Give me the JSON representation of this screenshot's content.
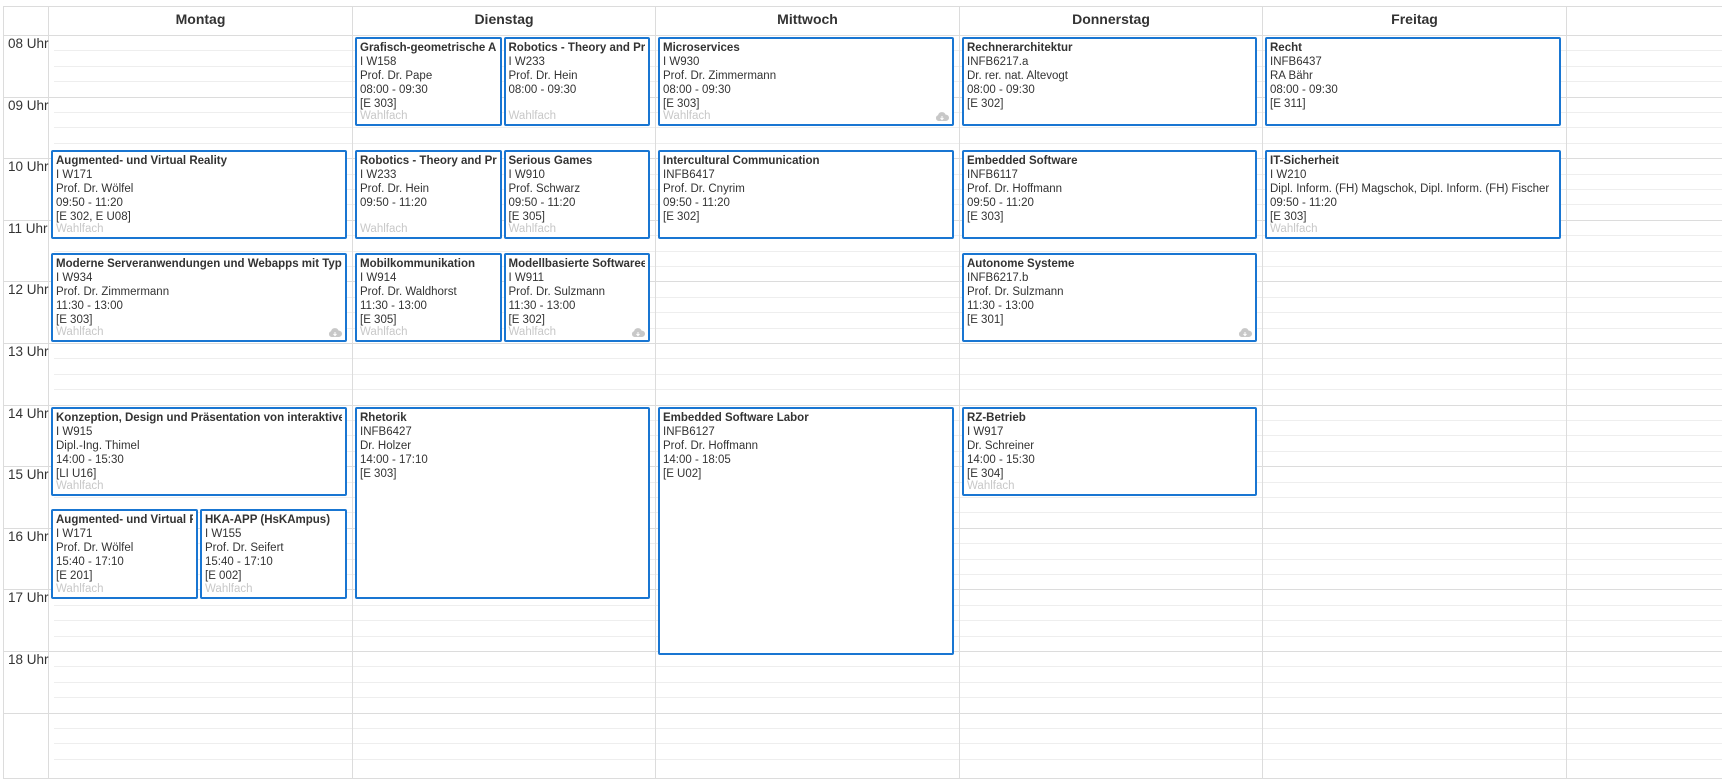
{
  "hours": [
    "08 Uhr",
    "09 Uhr",
    "10 Uhr",
    "11 Uhr",
    "12 Uhr",
    "13 Uhr",
    "14 Uhr",
    "15 Uhr",
    "16 Uhr",
    "17 Uhr",
    "18 Uhr"
  ],
  "days": [
    "Montag",
    "Dienstag",
    "Mittwoch",
    "Donnerstag",
    "Freitag"
  ],
  "events": [
    {
      "title": "Grafisch-geometrische Algorithmen",
      "code": "I W158",
      "lecturer": "Prof. Dr. Pape",
      "time": "08:00 - 09:30",
      "room": "[E 303]",
      "badge": "Wahlfach",
      "cloud": false
    },
    {
      "title": "Robotics - Theory and Practice",
      "code": "I W233",
      "lecturer": "Prof. Dr. Hein",
      "time": "08:00 - 09:30",
      "room": "",
      "badge": "Wahlfach",
      "cloud": false
    },
    {
      "title": "Microservices",
      "code": "I W930",
      "lecturer": "Prof. Dr. Zimmermann",
      "time": "08:00 - 09:30",
      "room": "[E 303]",
      "badge": "Wahlfach",
      "cloud": true
    },
    {
      "title": "Rechnerarchitektur",
      "code": "INFB6217.a",
      "lecturer": "Dr. rer. nat. Altevogt",
      "time": "08:00 - 09:30",
      "room": "[E 302]",
      "badge": "",
      "cloud": false
    },
    {
      "title": "Recht",
      "code": "INFB6437",
      "lecturer": "RA Bähr",
      "time": "08:00 - 09:30",
      "room": "[E 311]",
      "badge": "",
      "cloud": false
    },
    {
      "title": "Augmented- und Virtual Reality",
      "code": "I W171",
      "lecturer": "Prof. Dr. Wölfel",
      "time": "09:50 - 11:20",
      "room": "[E 302, E U08]",
      "badge": "Wahlfach",
      "cloud": false
    },
    {
      "title": "Robotics - Theory and Practice",
      "code": "I W233",
      "lecturer": "Prof. Dr. Hein",
      "time": "09:50 - 11:20",
      "room": "",
      "badge": "Wahlfach",
      "cloud": false
    },
    {
      "title": "Serious Games",
      "code": "I W910",
      "lecturer": "Prof. Schwarz",
      "time": "09:50 - 11:20",
      "room": "[E 305]",
      "badge": "Wahlfach",
      "cloud": false
    },
    {
      "title": "Intercultural Communication",
      "code": "INFB6417",
      "lecturer": "Prof. Dr. Cnyrim",
      "time": "09:50 - 11:20",
      "room": "[E 302]",
      "badge": "",
      "cloud": false
    },
    {
      "title": "Embedded Software",
      "code": "INFB6117",
      "lecturer": "Prof. Dr. Hoffmann",
      "time": "09:50 - 11:20",
      "room": "[E 303]",
      "badge": "",
      "cloud": false
    },
    {
      "title": "IT-Sicherheit",
      "code": "I W210",
      "lecturer": "Dipl. Inform. (FH) Magschok, Dipl. Inform. (FH) Fischer",
      "time": "09:50 - 11:20",
      "room": "[E 303]",
      "badge": "Wahlfach",
      "cloud": false
    },
    {
      "title": "Moderne Serveranwendungen und Webapps mit TypeScript",
      "code": "I W934",
      "lecturer": "Prof. Dr. Zimmermann",
      "time": "11:30 - 13:00",
      "room": "[E 303]",
      "badge": "Wahlfach",
      "cloud": true
    },
    {
      "title": "Mobilkommunikation",
      "code": "I W914",
      "lecturer": "Prof. Dr. Waldhorst",
      "time": "11:30 - 13:00",
      "room": "[E 305]",
      "badge": "Wahlfach",
      "cloud": false
    },
    {
      "title": "Modellbasierte Softwareentwicklung",
      "code": "I W911",
      "lecturer": "Prof. Dr. Sulzmann",
      "time": "11:30 - 13:00",
      "room": "[E 302]",
      "badge": "Wahlfach",
      "cloud": true
    },
    {
      "title": "Autonome Systeme",
      "code": "INFB6217.b",
      "lecturer": "Prof. Dr. Sulzmann",
      "time": "11:30 - 13:00",
      "room": "[E 301]",
      "badge": "",
      "cloud": true
    },
    {
      "title": "Konzeption, Design und Präsentation von interaktiven Projekten",
      "code": "I W915",
      "lecturer": "Dipl.-Ing. Thimel",
      "time": "14:00 - 15:30",
      "room": "[LI U16]",
      "badge": "Wahlfach",
      "cloud": false
    },
    {
      "title": "Rhetorik",
      "code": "INFB6427",
      "lecturer": "Dr. Holzer",
      "time": "14:00 - 17:10",
      "room": "[E 303]",
      "badge": "",
      "cloud": false
    },
    {
      "title": "Embedded Software Labor",
      "code": "INFB6127",
      "lecturer": "Prof. Dr. Hoffmann",
      "time": "14:00 - 18:05",
      "room": "[E U02]",
      "badge": "",
      "cloud": false
    },
    {
      "title": "RZ-Betrieb",
      "code": "I W917",
      "lecturer": "Dr. Schreiner",
      "time": "14:00 - 15:30",
      "room": "[E 304]",
      "badge": "Wahlfach",
      "cloud": false
    },
    {
      "title": "Augmented- und Virtual Reality",
      "code": "I W171",
      "lecturer": "Prof. Dr. Wölfel",
      "time": "15:40 - 17:10",
      "room": "[E 201]",
      "badge": "Wahlfach",
      "cloud": false
    },
    {
      "title": "HKA-APP (HsKAmpus)",
      "code": "I W155",
      "lecturer": "Prof. Dr. Seifert",
      "time": "15:40 - 17:10",
      "room": "[E 002]",
      "badge": "Wahlfach",
      "cloud": false
    }
  ]
}
